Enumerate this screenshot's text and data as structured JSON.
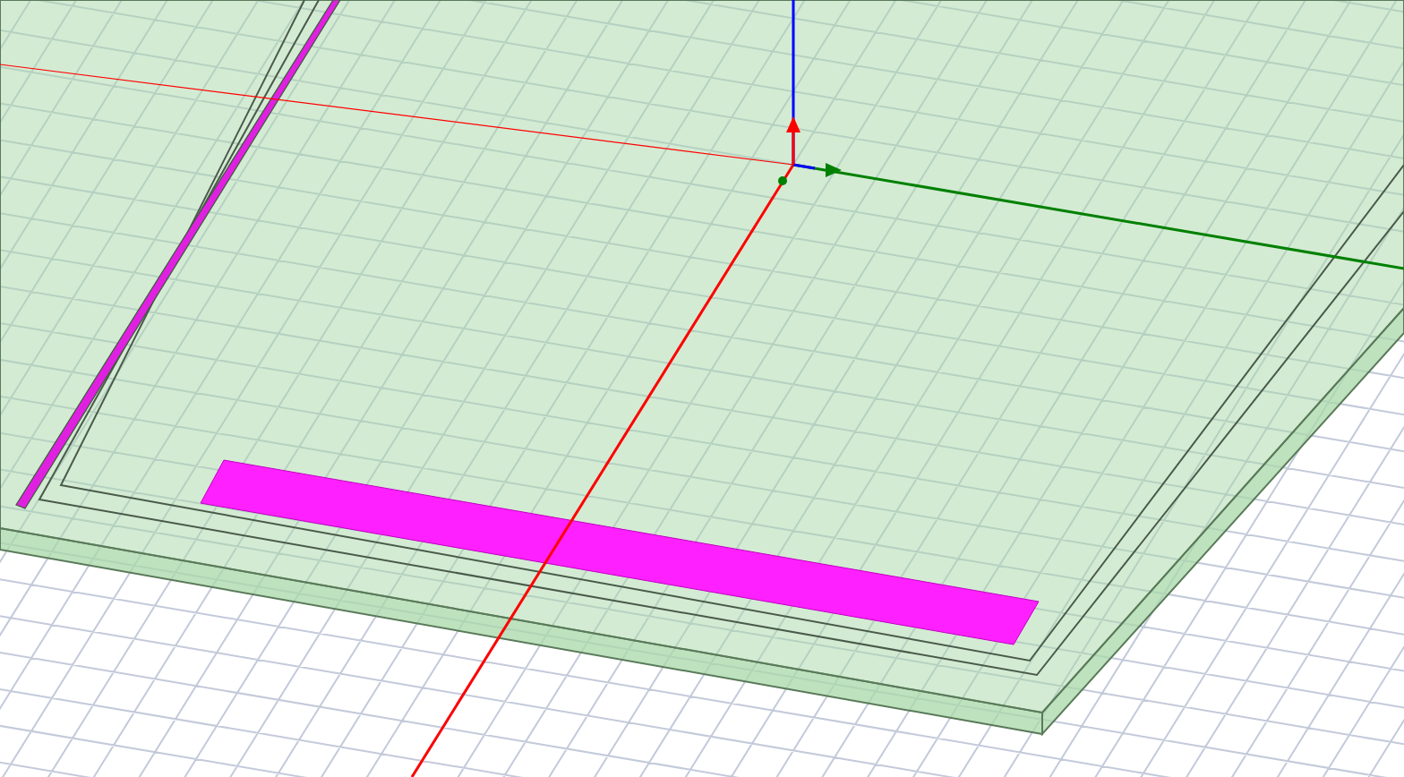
{
  "viewport": {
    "axes": [
      {
        "kind": "x",
        "color": "#ff0000"
      },
      {
        "kind": "y",
        "color": "#008000"
      },
      {
        "kind": "z",
        "color": "#0000ff"
      }
    ],
    "objects": [
      {
        "kind": "substrate",
        "color": "#a8d8a8"
      },
      {
        "kind": "feed-line",
        "color": "#e020e0"
      },
      {
        "kind": "patch",
        "color": "#ff20ff"
      }
    ]
  }
}
